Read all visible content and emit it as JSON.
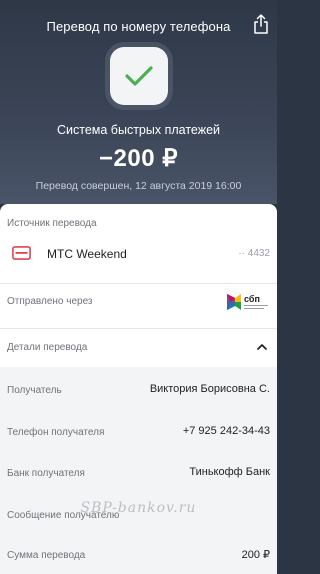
{
  "header": {
    "title": "Перевод по номеру телефона",
    "share_icon": "share-icon",
    "status_icon": "checkmark-icon",
    "system_name": "Система быстрых платежей",
    "amount": "−200 ₽",
    "status_text": "Перевод совершен, 12 августа 2019 16:00",
    "accent_color": "#4caf50"
  },
  "source": {
    "label": "Источник перевода",
    "card_icon": "card-icon",
    "card_name": "МТС Weekend",
    "card_number": "·· 4432",
    "card_color": "#e5404f"
  },
  "sent_via": {
    "label": "Отправлено через",
    "logo_text": "сбп",
    "logo_icon": "sbp-logo-icon"
  },
  "details": {
    "label": "Детали перевода",
    "toggle_icon": "chevron-up-icon",
    "rows": [
      {
        "key": "Получатель",
        "value": "Виктория Борисовна С."
      },
      {
        "key": "Телефон получателя",
        "value": "+7 925 242-34-43"
      },
      {
        "key": "Банк получателя",
        "value": "Тинькофф Банк"
      },
      {
        "key": "Сообщение получателю",
        "value": ""
      },
      {
        "key": "Сумма перевода",
        "value": "200 ₽"
      }
    ]
  },
  "watermark": "SBP-bankov.ru"
}
